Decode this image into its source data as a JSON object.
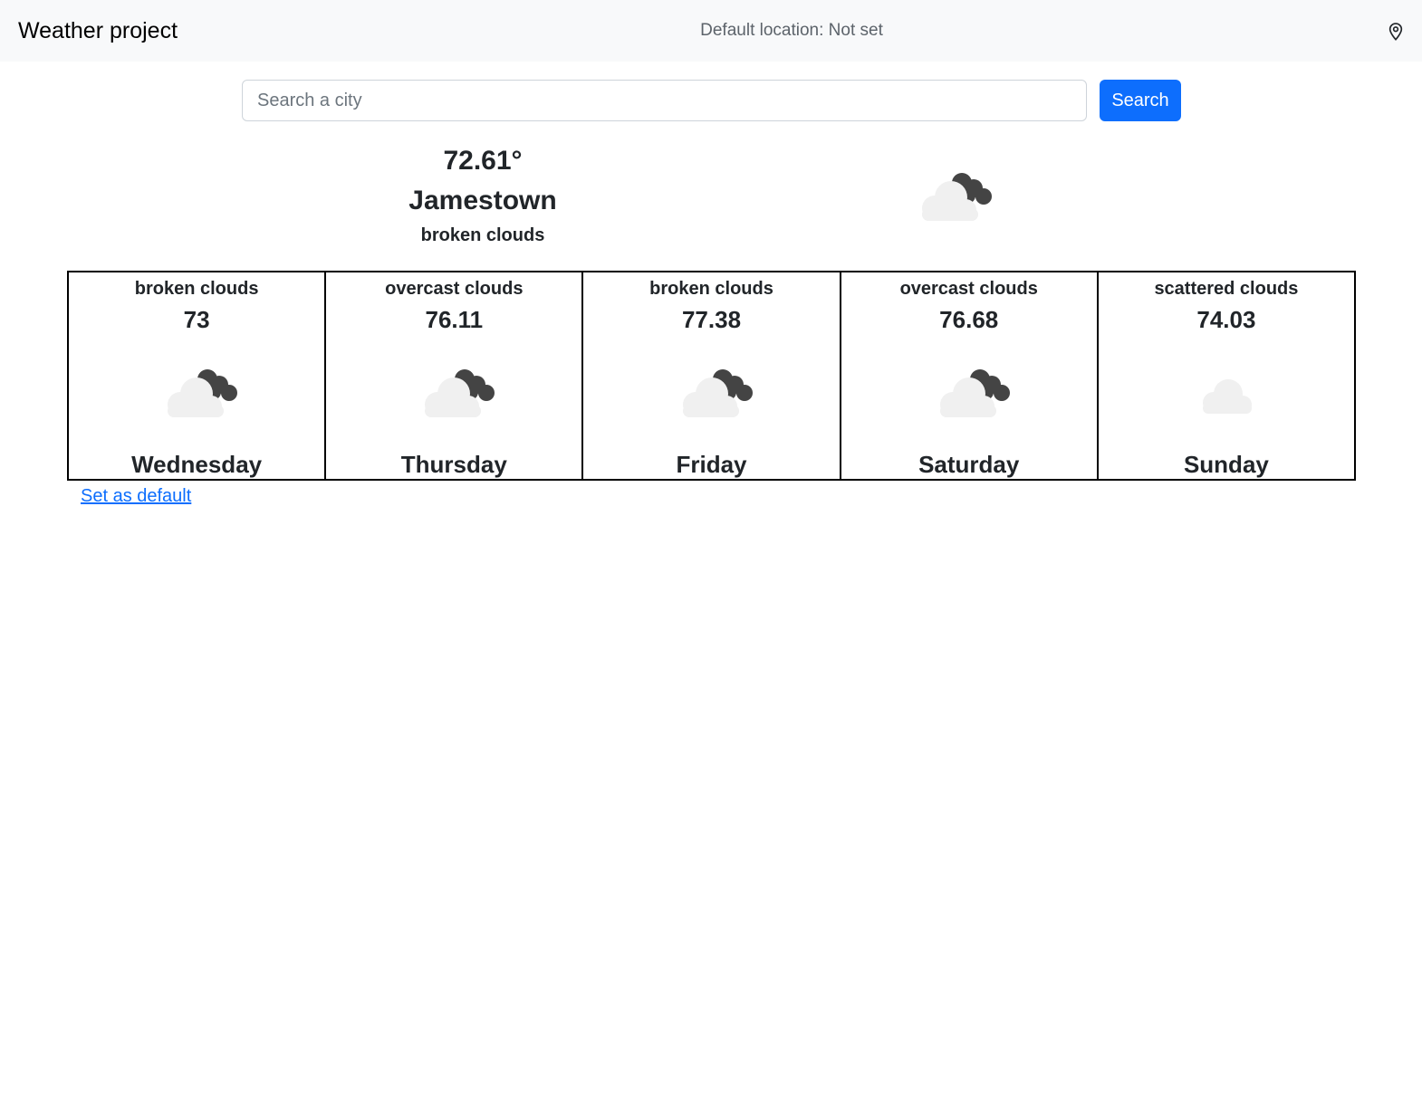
{
  "navbar": {
    "brand": "Weather project",
    "default_location": "Default location: Not set",
    "icon": "map-pin-icon"
  },
  "search": {
    "placeholder": "Search a city",
    "value": "",
    "button_label": "Search"
  },
  "current": {
    "temperature": "72.61°",
    "city": "Jamestown",
    "description": "broken clouds",
    "icon": "broken-clouds-icon"
  },
  "forecast": [
    {
      "description": "broken clouds",
      "temperature": "73",
      "day": "Wednesday",
      "icon": "broken-clouds-icon"
    },
    {
      "description": "overcast clouds",
      "temperature": "76.11",
      "day": "Thursday",
      "icon": "broken-clouds-icon"
    },
    {
      "description": "broken clouds",
      "temperature": "77.38",
      "day": "Friday",
      "icon": "broken-clouds-icon"
    },
    {
      "description": "overcast clouds",
      "temperature": "76.68",
      "day": "Saturday",
      "icon": "broken-clouds-icon"
    },
    {
      "description": "scattered clouds",
      "temperature": "74.03",
      "day": "Sunday",
      "icon": "scattered-clouds-icon"
    }
  ],
  "set_default_label": "Set as default",
  "colors": {
    "navbar_bg": "#f8f9fa",
    "primary": "#0d6efd",
    "cloud_light": "#f0f0f0",
    "cloud_dark": "#444444"
  }
}
